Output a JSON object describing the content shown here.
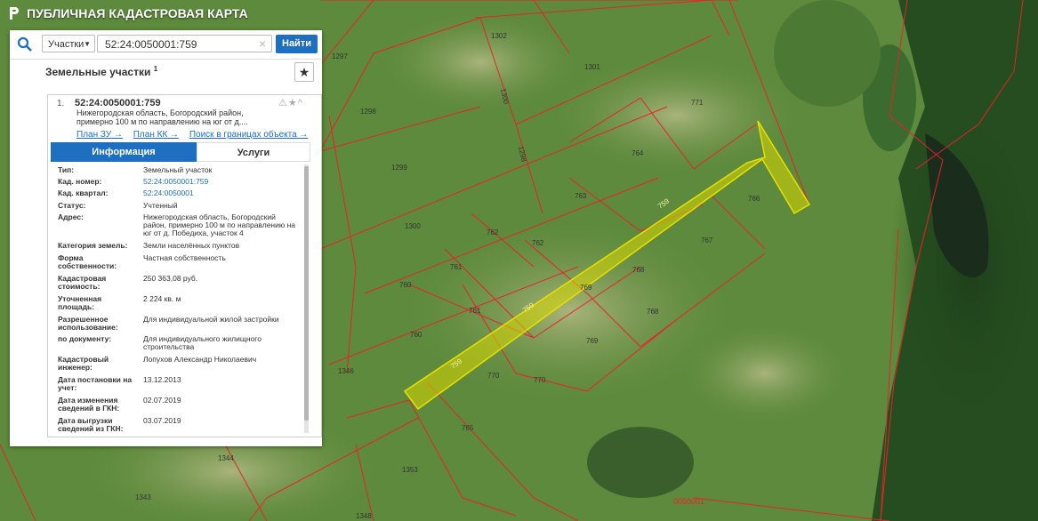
{
  "app": {
    "title": "ПУБЛИЧНАЯ КАДАСТРОВАЯ КАРТА"
  },
  "search": {
    "type_label": "Участки",
    "query": "52:24:0050001:759",
    "clear_symbol": "×",
    "find_label": "Найти"
  },
  "section": {
    "title": "Земельные участки",
    "count": "1"
  },
  "result": {
    "index": "1.",
    "cadastral_number": "52:24:0050001:759",
    "address_short": "Нижегородская область, Богородский район, примерно 100 м по направлению на юг от д....",
    "links": [
      "План ЗУ →",
      "План КК →",
      "Поиск в границах объекта →"
    ],
    "tabs": [
      "Информация",
      "Услуги"
    ],
    "rows": [
      {
        "k": "Тип:",
        "v": "Земельный участок"
      },
      {
        "k": "Кад. номер:",
        "v": "52:24:0050001:759"
      },
      {
        "k": "Кад. квартал:",
        "v": "52:24:0050001"
      },
      {
        "k": "Статус:",
        "v": "Учтенный"
      },
      {
        "k": "Адрес:",
        "v": "Нижегородская область, Богородский район, примерно 100 м по направлению на юг от д. Победиха, участок 4"
      },
      {
        "k": "Категория земель:",
        "v": "Земли населённых пунктов"
      },
      {
        "k": "Форма собственности:",
        "v": "Частная собственность"
      },
      {
        "k": "Кадастровая стоимость:",
        "v": "250 363,08 руб."
      },
      {
        "k": "Уточненная площадь:",
        "v": "2 224 кв. м"
      },
      {
        "k": "Разрешенное использование:",
        "v": "Для индивидуальной жилой застройки"
      },
      {
        "k": "по документу:",
        "v": "Для индивидуального жилищного строительства"
      },
      {
        "k": "Кадастровый инженер:",
        "v": "Лопухов Александр Николаевич"
      },
      {
        "k": "Дата постановки на учет:",
        "v": "13.12.2013"
      },
      {
        "k": "Дата изменения сведений в ГКН:",
        "v": "02.07.2019"
      },
      {
        "k": "Дата выгрузки сведений из ГКН:",
        "v": "03.07.2019"
      }
    ]
  },
  "map": {
    "labels": [
      "1302",
      "1297",
      "1301",
      "1300",
      "1298",
      "1299",
      "1300",
      "1346",
      "1344",
      "1343",
      "1353",
      "1348",
      "771",
      "764",
      "763",
      "762",
      "762",
      "761",
      "760",
      "761",
      "760",
      "769",
      "768",
      "768",
      "769",
      "767",
      "766",
      "770",
      "770",
      "765",
      "759",
      "759",
      "759",
      "0050001"
    ],
    "highlight_color": "#d8d800",
    "boundary_color": "#e8222a"
  }
}
